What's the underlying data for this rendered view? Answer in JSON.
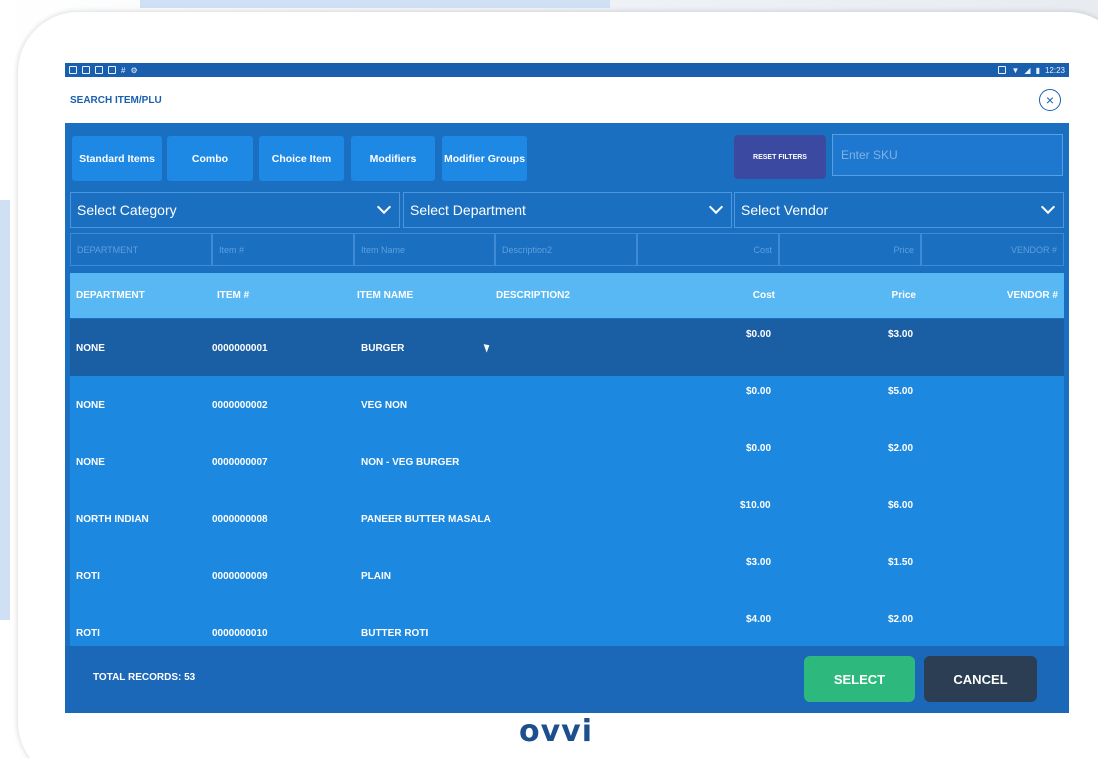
{
  "status_bar": {
    "left_icons": [
      "app-icon",
      "message-icon",
      "volume-icon",
      "download-icon",
      "hash-icon",
      "settings-icon"
    ],
    "right_icons": [
      "screen-icon",
      "wifi-icon",
      "signal-icon",
      "battery-icon"
    ],
    "time": "12:23"
  },
  "dialog": {
    "title": "SEARCH ITEM/PLU",
    "close_icon": "×"
  },
  "tabs": [
    {
      "label": "Standard Items"
    },
    {
      "label": "Combo"
    },
    {
      "label": "Choice Item"
    },
    {
      "label": "Modifiers"
    },
    {
      "label": "Modifier Groups"
    }
  ],
  "reset_filters_label": "RESET FILTERS",
  "sku_placeholder": "Enter SKU",
  "selects": {
    "category": "Select Category",
    "department": "Select Department",
    "vendor": "Select Vendor"
  },
  "filter_placeholders": [
    "DEPARTMENT",
    "Item #",
    "Item Name",
    "Description2",
    "Cost",
    "Price",
    "VENDOR #"
  ],
  "table": {
    "headers": {
      "department": "DEPARTMENT",
      "item": "ITEM #",
      "name": "ITEM NAME",
      "desc": "DESCRIPTION2",
      "cost": "Cost",
      "price": "Price",
      "vendor": "VENDOR #"
    },
    "rows": [
      {
        "department": "NONE",
        "item": "0000000001",
        "name": "BURGER",
        "desc": "",
        "cost": "$0.00",
        "price": "$3.00",
        "vendor": "",
        "selected": true
      },
      {
        "department": "NONE",
        "item": "0000000002",
        "name": "VEG NON",
        "desc": "",
        "cost": "$0.00",
        "price": "$5.00",
        "vendor": ""
      },
      {
        "department": "NONE",
        "item": "0000000007",
        "name": "NON - VEG BURGER",
        "desc": "",
        "cost": "$0.00",
        "price": "$2.00",
        "vendor": ""
      },
      {
        "department": "NORTH INDIAN",
        "item": "0000000008",
        "name": "PANEER BUTTER MASALA",
        "desc": "",
        "cost": "$10.00",
        "price": "$6.00",
        "vendor": ""
      },
      {
        "department": "ROTI",
        "item": "0000000009",
        "name": "PLAIN",
        "desc": "",
        "cost": "$3.00",
        "price": "$1.50",
        "vendor": ""
      },
      {
        "department": "ROTI",
        "item": "0000000010",
        "name": "BUTTER ROTI",
        "desc": "",
        "cost": "$4.00",
        "price": "$2.00",
        "vendor": ""
      }
    ]
  },
  "footer": {
    "total_records": "TOTAL RECORDS: 53",
    "select_label": "SELECT",
    "cancel_label": "CANCEL"
  },
  "brand": "ovvi",
  "colors": {
    "primary": "#1a6fc0",
    "tab": "#1e88e5",
    "header": "#58b8f4",
    "selected_row": "#1a5ea3",
    "reset": "#3b4aa0",
    "select_button": "#2db97d",
    "cancel_button": "#2c3e54"
  }
}
